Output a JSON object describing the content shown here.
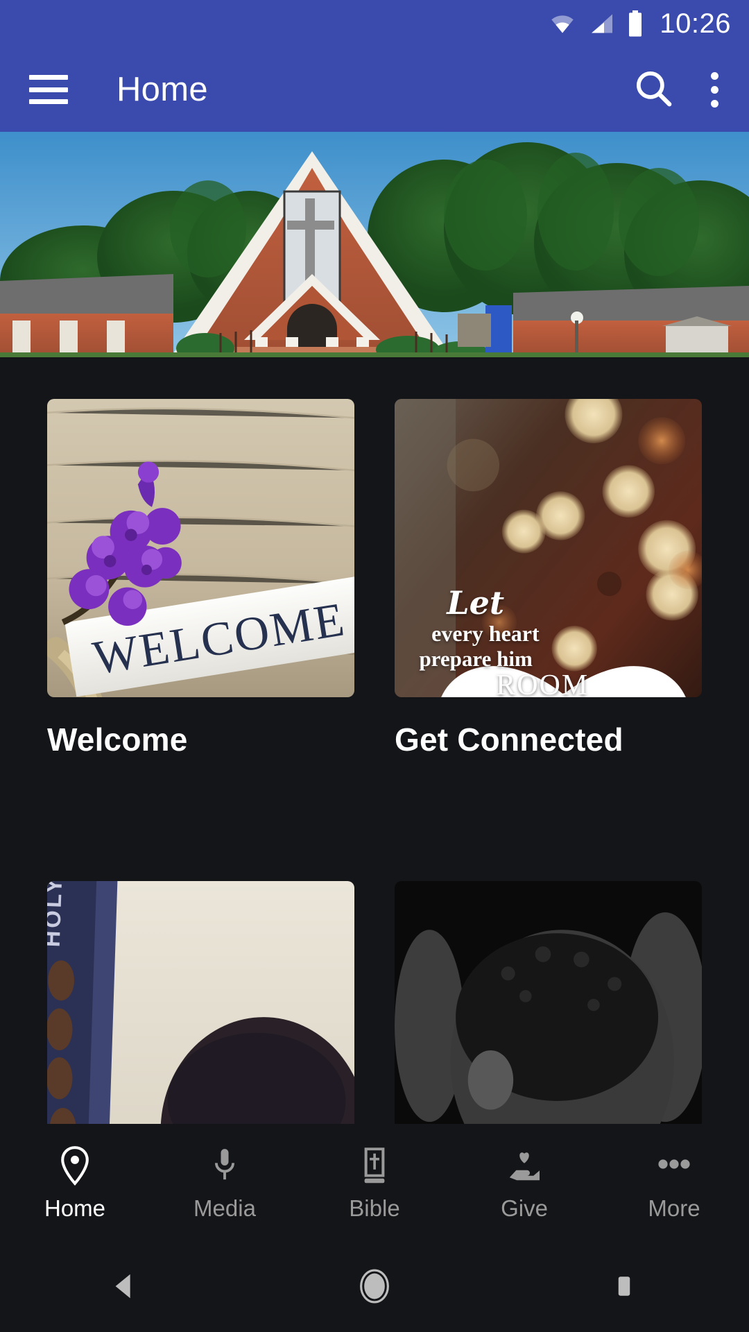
{
  "status_bar": {
    "time": "10:26",
    "icons": [
      "wifi-icon",
      "cellular-signal-icon",
      "battery-icon"
    ]
  },
  "app_bar": {
    "menu_icon": "hamburger-menu-icon",
    "title": "Home",
    "search_icon": "search-icon",
    "overflow_icon": "overflow-menu-icon",
    "background_color": "#3A4BAD"
  },
  "hero": {
    "alt": "brick church building with steep gable roof and cross window under blue sky"
  },
  "cards": [
    {
      "label": "Welcome",
      "image": "welcome-flowers-sign"
    },
    {
      "label": "Get Connected",
      "image": "bokeh-lights-christmas"
    },
    {
      "label": "",
      "image": "man-holding-bible"
    },
    {
      "label": "",
      "image": "man-praying-black-and-white"
    }
  ],
  "card_overlay": {
    "heart_icon": "heart-icon",
    "line1": "Let",
    "line2": "every heart",
    "line3": "prepare him",
    "line4": "ROOM"
  },
  "bottom_nav": {
    "items": [
      {
        "label": "Home",
        "icon": "location-pin-icon",
        "active": true
      },
      {
        "label": "Media",
        "icon": "microphone-icon",
        "active": false
      },
      {
        "label": "Bible",
        "icon": "bible-book-icon",
        "active": false
      },
      {
        "label": "Give",
        "icon": "hand-heart-icon",
        "active": false
      },
      {
        "label": "More",
        "icon": "more-dots-icon",
        "active": false
      }
    ],
    "active_color": "#FFFFFF",
    "inactive_color": "#9A9A9A"
  },
  "system_nav": {
    "back_icon": "back-triangle-icon",
    "home_icon": "home-circle-icon",
    "recents_icon": "recents-square-icon"
  },
  "theme": {
    "background": "#141518",
    "accent": "#3A4BAD"
  }
}
